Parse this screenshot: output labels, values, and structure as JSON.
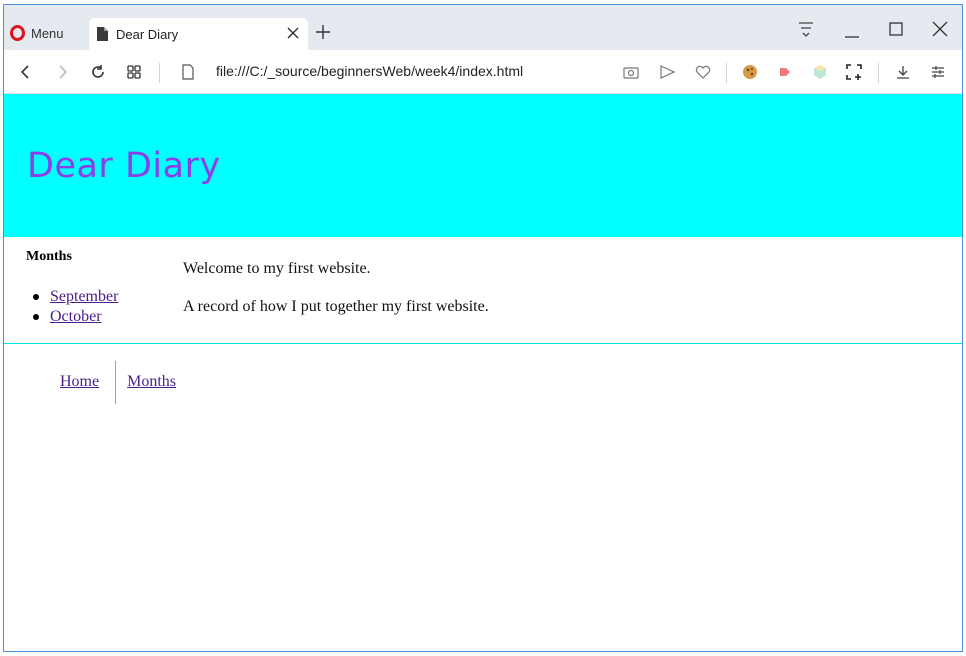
{
  "browser": {
    "menu_label": "Menu",
    "tab_title": "Dear Diary",
    "url": "file:///C:/_source/beginnersWeb/week4/index.html"
  },
  "page": {
    "header_title": "Dear Diary",
    "sidebar": {
      "heading": "Months",
      "links": [
        "September",
        "October"
      ]
    },
    "main": {
      "paragraphs": [
        "Welcome to my first website.",
        "A record of how I put together my first website."
      ]
    },
    "footer_nav": [
      "Home",
      "Months"
    ]
  },
  "colors": {
    "header_bg": "#00ffff",
    "title_color": "#8a3fe8",
    "link_color": "#4b1d8a"
  }
}
